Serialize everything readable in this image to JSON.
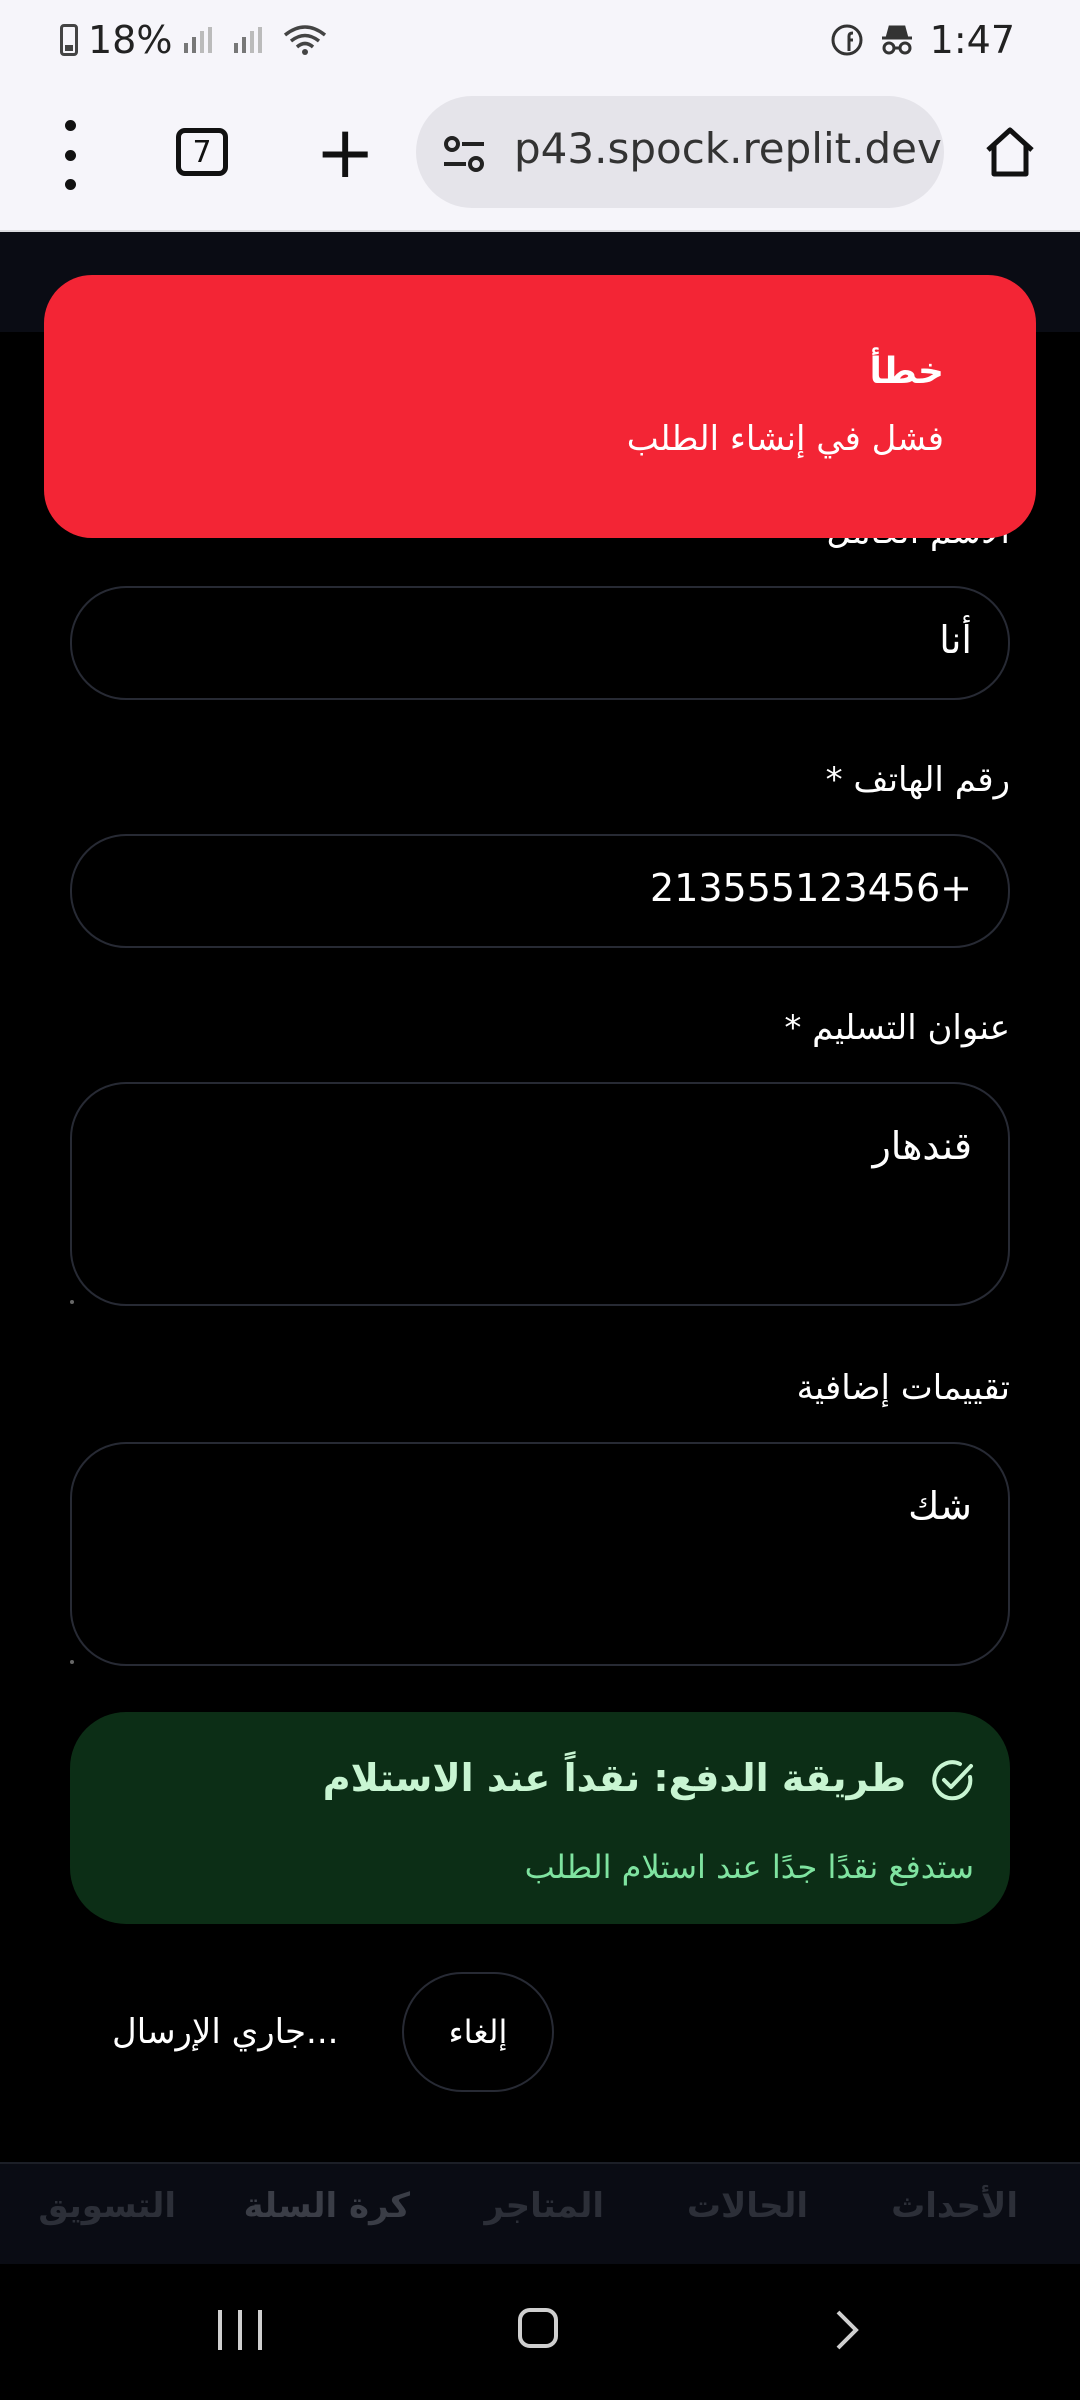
{
  "status_bar": {
    "battery": "18%",
    "time": "1:47"
  },
  "browser": {
    "tab_count": "7",
    "url": "p43.spock.replit.dev"
  },
  "toast": {
    "title": "خطأ",
    "description": "فشل في إنشاء الطلب"
  },
  "form": {
    "name_label": "الاسم الكامل",
    "name_value": "أنا",
    "phone_label": "رقم الهاتف *",
    "phone_value": "+213555123456",
    "address_label": "عنوان التسليم *",
    "address_value": "قندهار",
    "notes_label": "تقييمات إضافية",
    "notes_value": "شك"
  },
  "payment": {
    "title": "طريقة الدفع: نقداً عند الاستلام",
    "description": "ستدفع نقدًا جدًا عند استلام الطلب"
  },
  "actions": {
    "cancel_label": "إلغاء",
    "submit_label": "جاري الإرسال..."
  },
  "bottom_nav": {
    "items": [
      "الأحداث",
      "الحالات",
      "المتاجر",
      "كرة السلة",
      "التسويق"
    ]
  }
}
